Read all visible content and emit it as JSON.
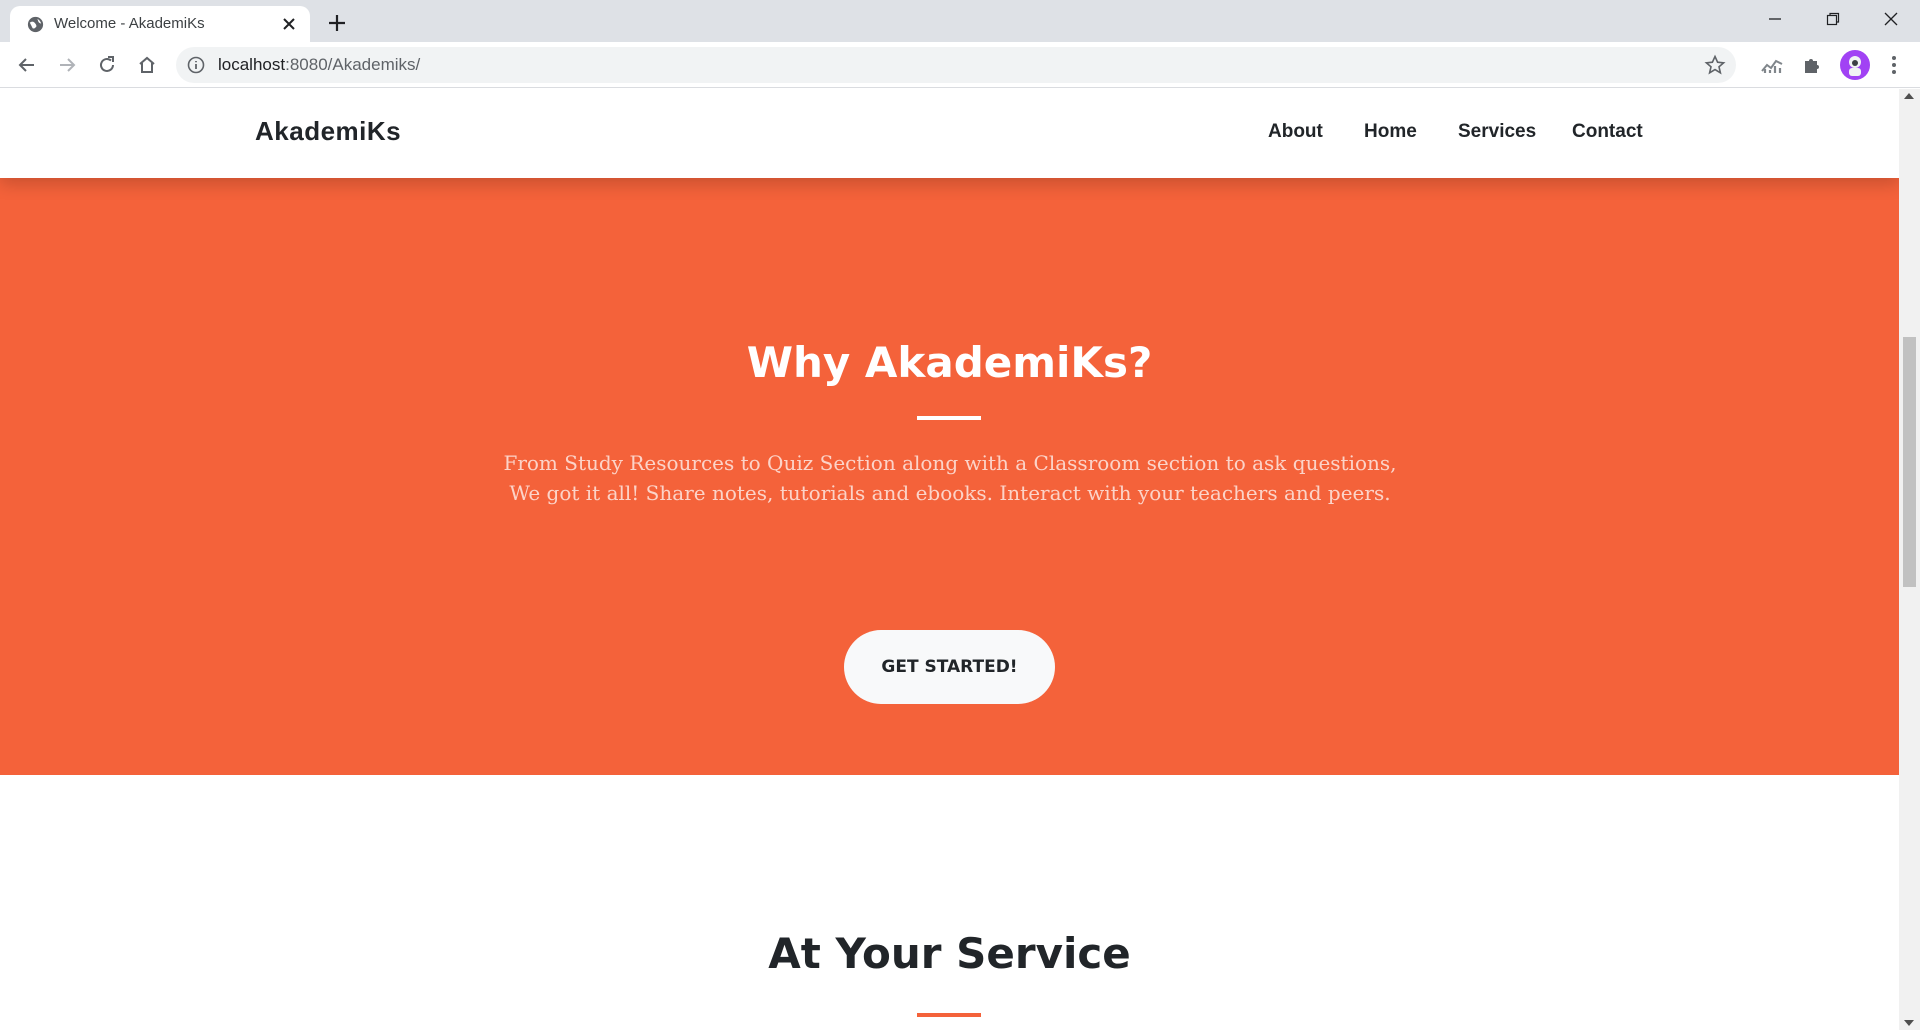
{
  "browser": {
    "tab_title": "Welcome - AkademiKs",
    "url_host": "localhost",
    "url_rest": ":8080/Akademiks/"
  },
  "site": {
    "brand": "AkademiKs",
    "nav": [
      {
        "label": "About"
      },
      {
        "label": "Home"
      },
      {
        "label": "Services"
      },
      {
        "label": "Contact"
      }
    ]
  },
  "hero": {
    "title": "Why AkademiKs?",
    "text": "From Study Resources to Quiz Section along with a Classroom section to ask questions, We got it all! Share notes, tutorials and ebooks. Interact with your teachers and peers.",
    "button": "GET STARTED!"
  },
  "services": {
    "title": "At Your Service"
  },
  "colors": {
    "accent": "#f4623a",
    "dark": "#212529",
    "avatar": "#a142f4"
  }
}
